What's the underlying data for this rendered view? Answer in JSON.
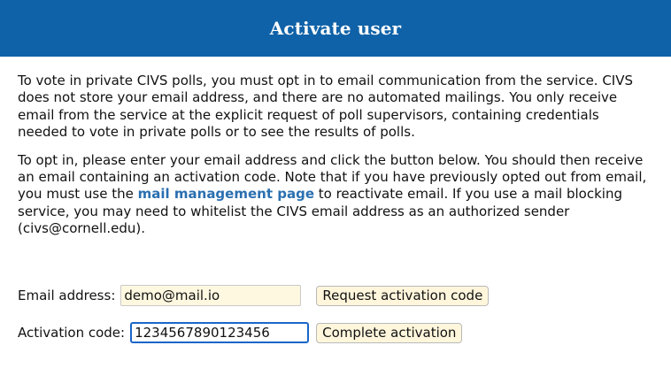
{
  "header": {
    "title": "Activate user",
    "bg_color": "#0f62a8"
  },
  "content": {
    "paragraph1": "To vote in private CIVS polls, you must opt in to email communication from the service. CIVS does not store your email address, and there are no automated mailings. You only receive email from the service at the explicit request of poll supervisors, containing credentials needed to vote in private polls or to see the results of polls.",
    "paragraph2_before_link": "To opt in, please enter your email address and click the button below. You should then receive an email containing an activation code. Note that if you have previously opted out from email, you must use the ",
    "paragraph2_link": "mail management page",
    "paragraph2_after_link": " to reactivate email. If you use a mail blocking service, you may need to whitelist the CIVS email address as an authorized sender (civs@cornell.edu)."
  },
  "form": {
    "email_label": "Email address:",
    "email_value": "demo@mail.io",
    "request_button": "Request activation code",
    "code_label": "Activation code:",
    "code_value": "1234567890123456",
    "complete_button": "Complete activation"
  }
}
